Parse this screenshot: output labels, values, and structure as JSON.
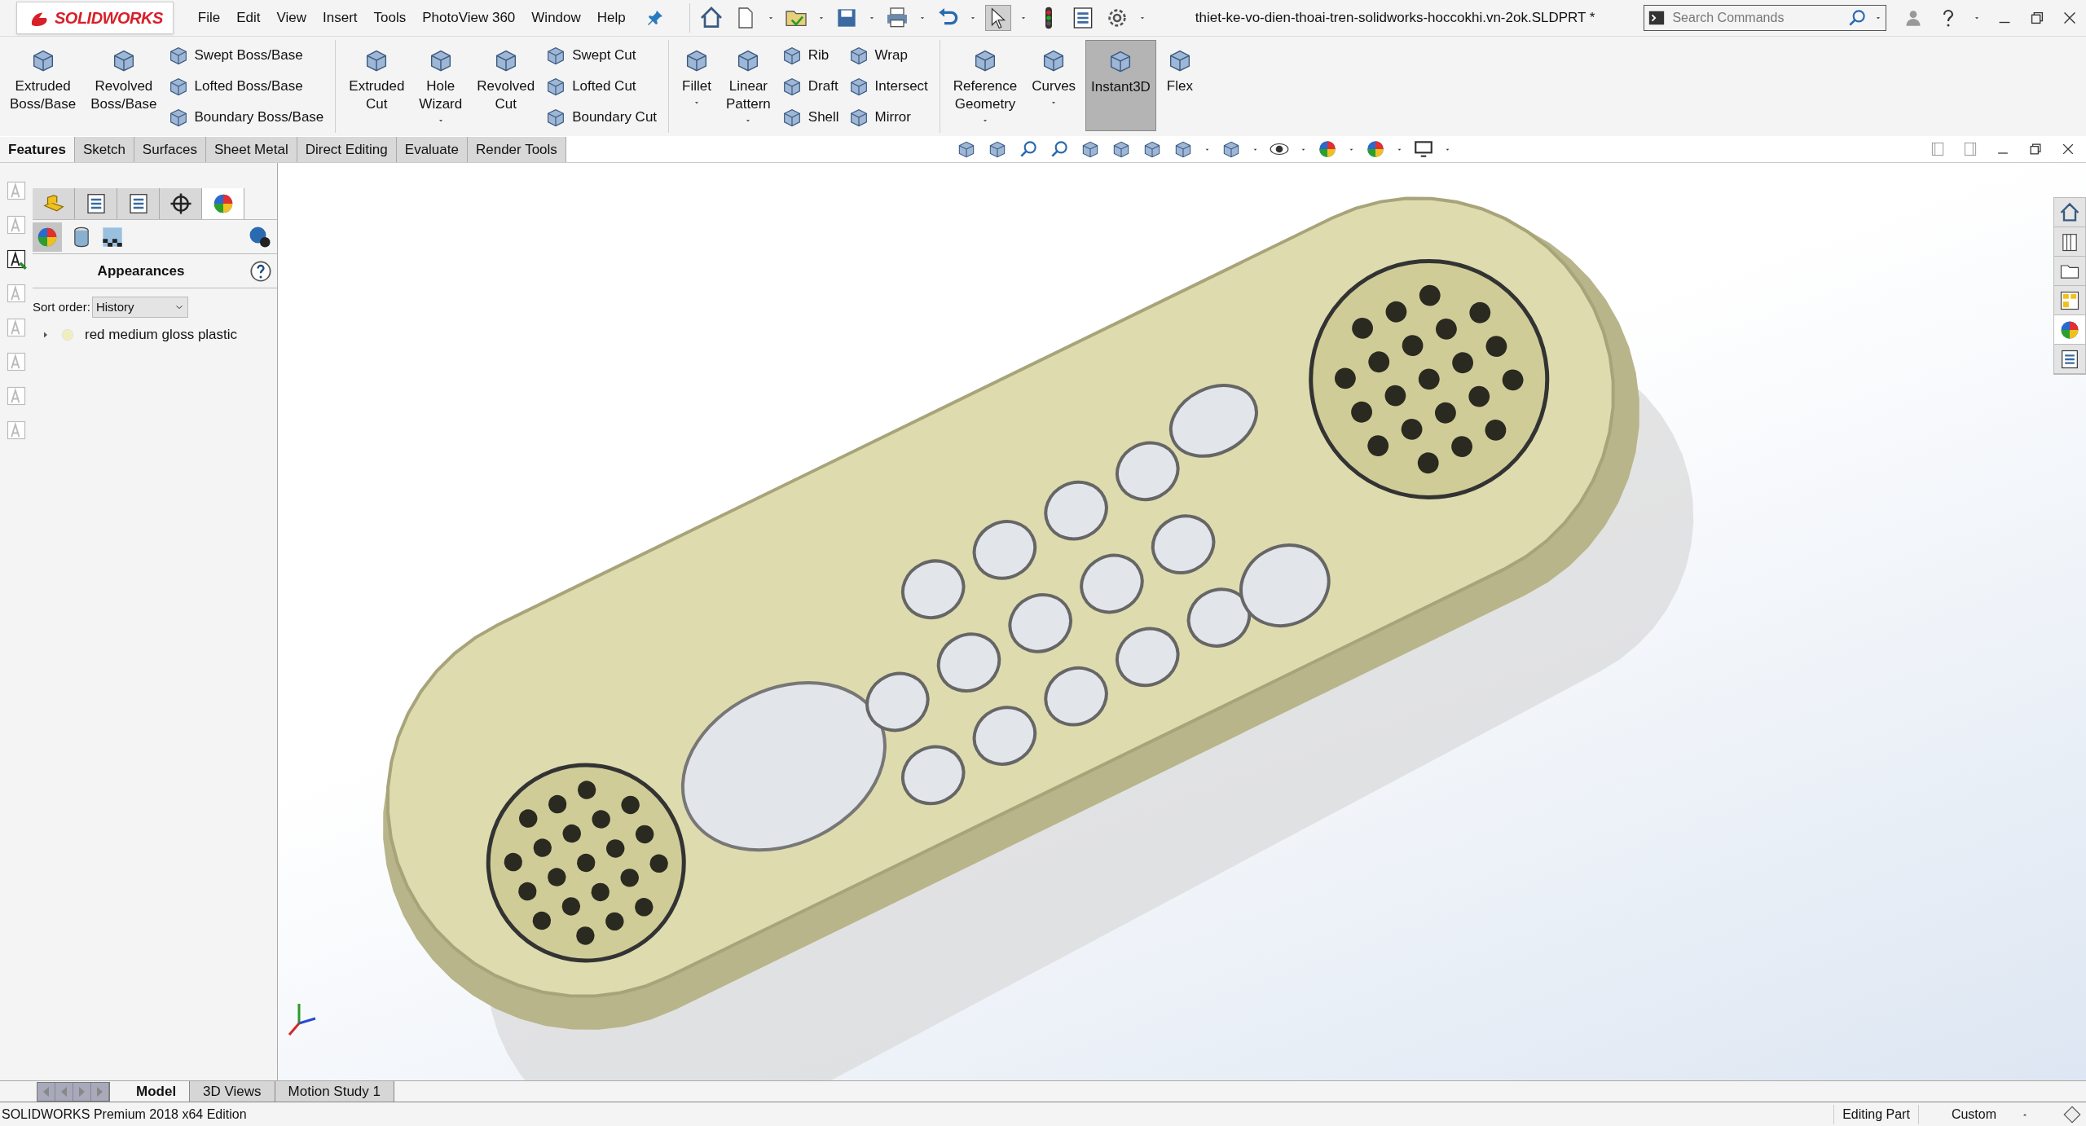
{
  "title_bar": {
    "app_name": "SOLIDWORKS",
    "menu": [
      "File",
      "Edit",
      "View",
      "Insert",
      "Tools",
      "PhotoView 360",
      "Window",
      "Help"
    ],
    "document_title": "thiet-ke-vo-dien-thoai-tren-solidworks-hoccokhi.vn-2ok.SLDPRT *",
    "search": {
      "placeholder": "Search Commands"
    }
  },
  "ribbon": [
    {
      "items": [
        {
          "kind": "large",
          "label": "Extruded Boss/Base",
          "dropdown": false,
          "on": false
        },
        {
          "kind": "large",
          "label": "Revolved Boss/Base",
          "dropdown": false,
          "on": false
        },
        {
          "kind": "stack",
          "items": [
            {
              "label": "Swept Boss/Base"
            },
            {
              "label": "Lofted Boss/Base"
            },
            {
              "label": "Boundary Boss/Base"
            }
          ]
        }
      ]
    },
    {
      "items": [
        {
          "kind": "large",
          "label": "Extruded Cut",
          "dropdown": false,
          "on": false
        },
        {
          "kind": "large",
          "label": "Hole Wizard",
          "dropdown": true,
          "on": false
        },
        {
          "kind": "large",
          "label": "Revolved Cut",
          "dropdown": false,
          "on": false
        },
        {
          "kind": "stack",
          "items": [
            {
              "label": "Swept Cut"
            },
            {
              "label": "Lofted Cut"
            },
            {
              "label": "Boundary Cut"
            }
          ]
        }
      ]
    },
    {
      "items": [
        {
          "kind": "large",
          "label": "Fillet",
          "dropdown": true,
          "on": false
        },
        {
          "kind": "large",
          "label": "Linear Pattern",
          "dropdown": true,
          "on": false
        },
        {
          "kind": "stack",
          "items": [
            {
              "label": "Rib"
            },
            {
              "label": "Draft"
            },
            {
              "label": "Shell"
            }
          ]
        },
        {
          "kind": "stack",
          "items": [
            {
              "label": "Wrap"
            },
            {
              "label": "Intersect"
            },
            {
              "label": "Mirror"
            }
          ]
        }
      ]
    },
    {
      "items": [
        {
          "kind": "large",
          "label": "Reference Geometry",
          "dropdown": true,
          "on": false
        },
        {
          "kind": "large",
          "label": "Curves",
          "dropdown": true,
          "on": false
        },
        {
          "kind": "large",
          "label": "Instant3D",
          "dropdown": false,
          "on": true
        },
        {
          "kind": "large",
          "label": "Flex",
          "dropdown": false,
          "on": false
        }
      ]
    }
  ],
  "command_tabs": [
    {
      "label": "Features",
      "selected": true
    },
    {
      "label": "Sketch",
      "selected": false
    },
    {
      "label": "Surfaces",
      "selected": false
    },
    {
      "label": "Sheet Metal",
      "selected": false
    },
    {
      "label": "Direct Editing",
      "selected": false
    },
    {
      "label": "Evaluate",
      "selected": false
    },
    {
      "label": "Render Tools",
      "selected": false
    }
  ],
  "panel": {
    "title": "Appearances",
    "sort_label": "Sort order:",
    "sort_value": "History",
    "tree": [
      {
        "label": "red medium gloss plastic",
        "expanded": false
      }
    ]
  },
  "bottom_tabs": [
    {
      "label": "Model",
      "selected": true
    },
    {
      "label": "3D Views",
      "selected": false
    },
    {
      "label": "Motion Study 1",
      "selected": false
    }
  ],
  "status_bar": {
    "edition": "SOLIDWORKS Premium 2018 x64 Edition",
    "mode": "Editing Part",
    "units": "Custom"
  }
}
